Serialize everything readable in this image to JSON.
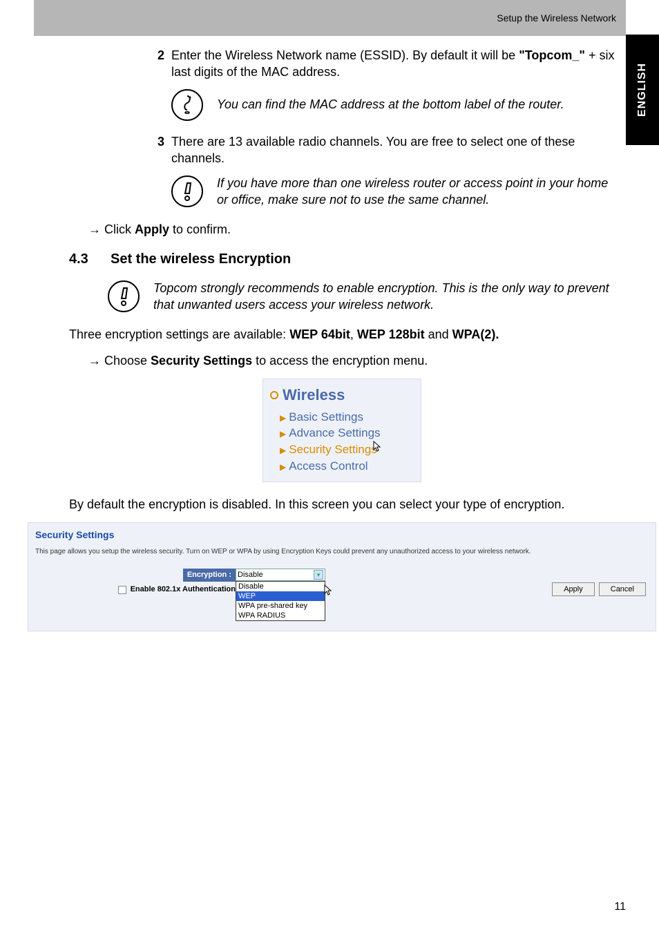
{
  "header": "Setup the Wireless Network",
  "side_tab": "ENGLISH",
  "step2": {
    "num": "2",
    "text_a": "Enter the Wireless Network name (ESSID). By default it will be ",
    "bold": "\"Topcom_\"",
    "text_b": " + six last digits of the MAC address."
  },
  "note1": "You can find the MAC address at the bottom label of the router.",
  "step3": {
    "num": "3",
    "text": "There are 13 available radio channels. You are free to select one of these channels."
  },
  "note2": "If you have more than one wireless router or access point in your home or office, make sure not to use the same channel.",
  "apply_line": {
    "arrow": "→",
    "pre": " Click ",
    "bold": "Apply",
    "post": " to confirm."
  },
  "section": {
    "num": "4.3",
    "title": "Set the wireless Encryption"
  },
  "note3": "Topcom strongly recommends to enable encryption. This is the only way to prevent that unwanted users access your wireless network.",
  "para_enc": {
    "a": "Three encryption settings are available: ",
    "b1": "WEP 64bit",
    "c1": ", ",
    "b2": "WEP 128bit",
    "c2": " and ",
    "b3": "WPA(2)."
  },
  "choose_line": {
    "arrow": "→",
    "pre": " Choose ",
    "bold": "Security Settings",
    "post": " to access the encryption menu."
  },
  "wireless_menu": {
    "title": "Wireless",
    "items": [
      "Basic Settings",
      "Advance Settings",
      "Security Settings",
      "Access Control"
    ]
  },
  "para_default": "By default the encryption is disabled. In this screen you can select your type of encryption.",
  "sec_fig": {
    "title": "Security Settings",
    "desc": "This page allows you setup the wireless security. Turn on WEP or WPA by using Encryption Keys could prevent any unauthorized access to your wireless network.",
    "label_enc": "Encryption :",
    "label_auth": "Enable 802.1x Authentication",
    "select_value": "Disable",
    "options": [
      "Disable",
      "WEP",
      "WPA pre-shared key",
      "WPA RADIUS"
    ],
    "btn_apply": "Apply",
    "btn_cancel": "Cancel"
  },
  "page_number": "11"
}
